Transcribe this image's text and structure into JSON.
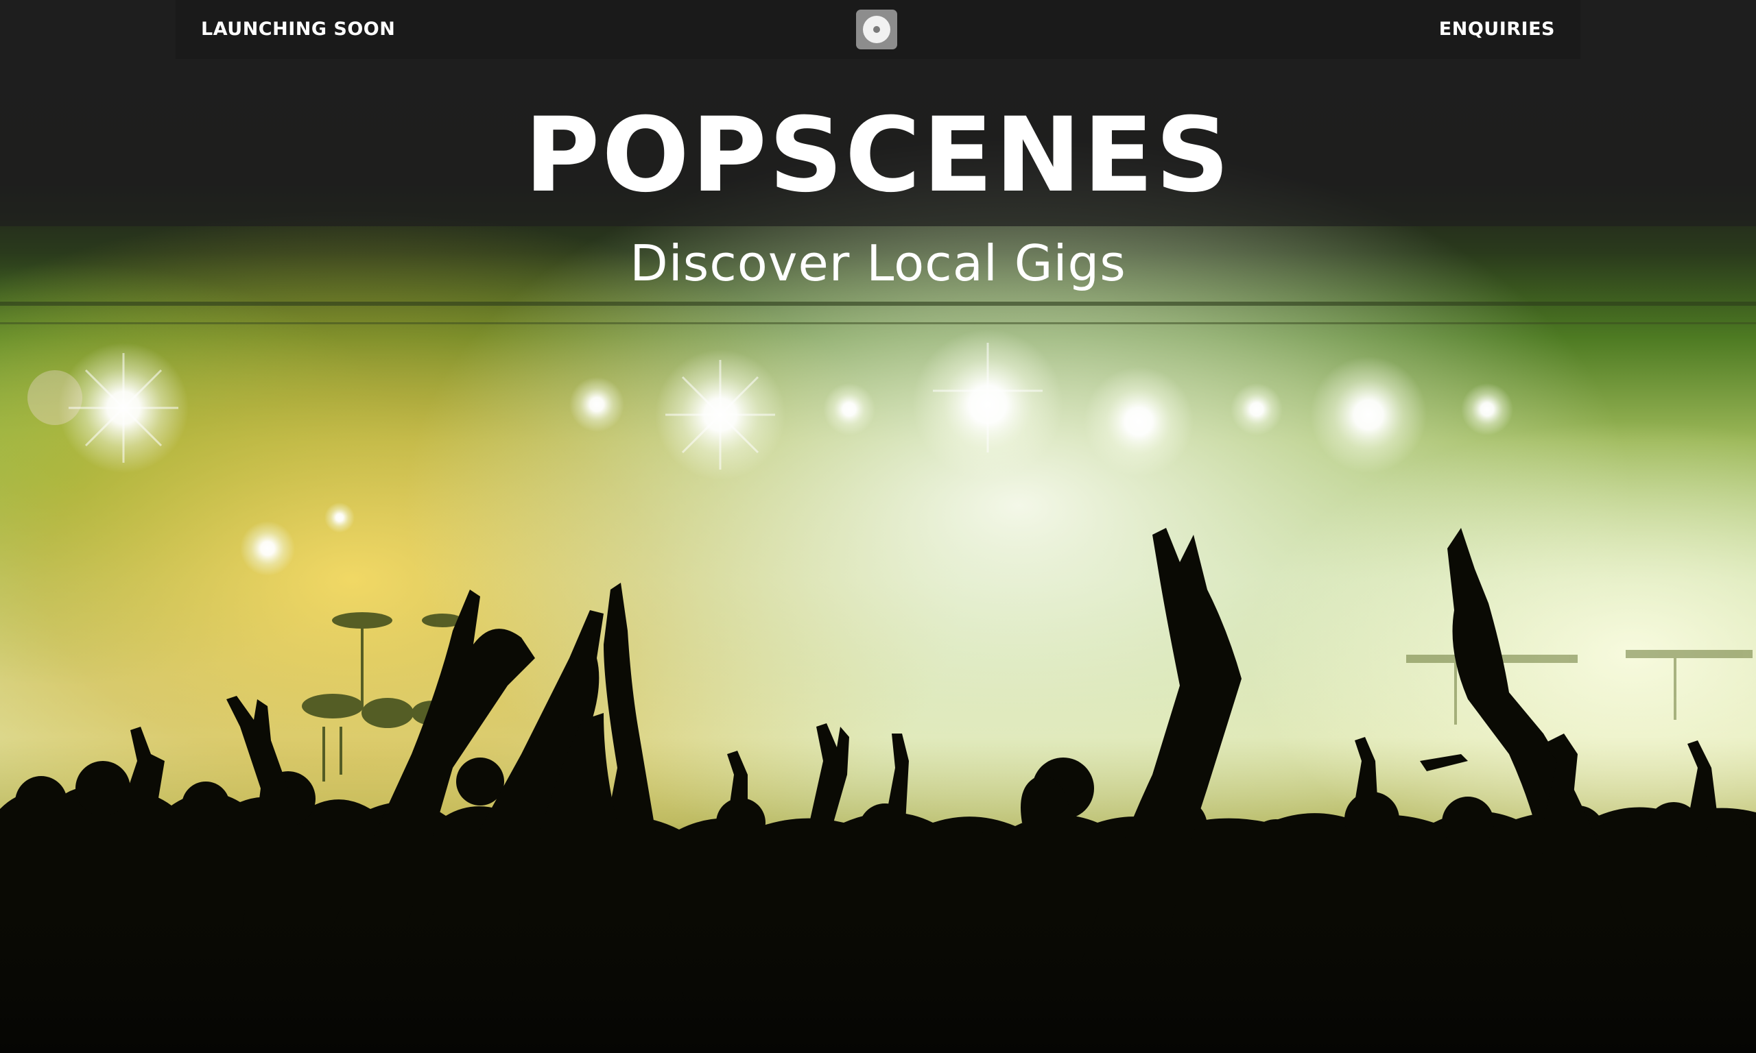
{
  "nav": {
    "left_label": "LAUNCHING SOON",
    "right_label": "ENQUIRIES",
    "logo_icon": "disc-icon"
  },
  "hero": {
    "title": "POPSCENES",
    "subtitle": "Discover Local Gigs",
    "background_description_icon": "concert-crowd-image"
  },
  "colors": {
    "topbar": "#1a1a1a",
    "background": "#1e1e1e",
    "stage_green": "#5a9a2a",
    "stage_yellow": "#d8c23a",
    "text": "#ffffff"
  }
}
